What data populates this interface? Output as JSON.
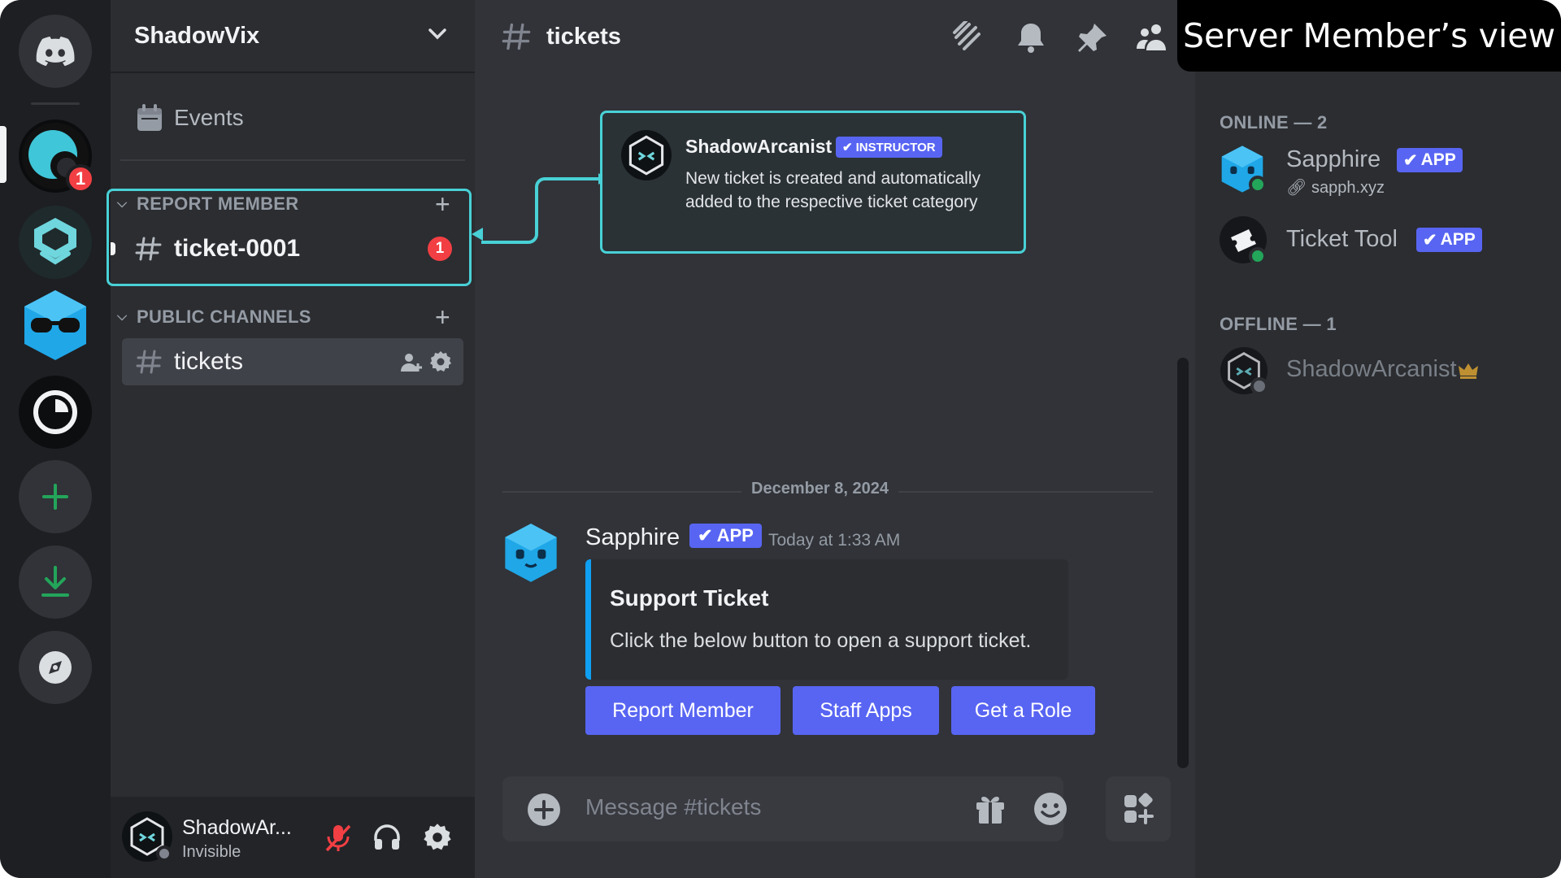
{
  "server": {
    "name": "ShadowVix",
    "events_label": "Events"
  },
  "rail": {
    "notification_count": "1"
  },
  "categories": [
    {
      "name": "REPORT MEMBER",
      "channels": [
        {
          "name": "ticket-0001",
          "unread": "1"
        }
      ]
    },
    {
      "name": "PUBLIC CHANNELS",
      "channels": [
        {
          "name": "tickets"
        }
      ]
    }
  ],
  "user_panel": {
    "name": "ShadowAr...",
    "status": "Invisible"
  },
  "channel_header": {
    "name": "tickets"
  },
  "view_label": "Server Member’s view",
  "callout": {
    "author": "ShadowArcanist",
    "tag": "INSTRUCTOR",
    "text": "New ticket is created and automatically added to the respective ticket category"
  },
  "chat": {
    "date_divider": "December 8, 2024",
    "message": {
      "author": "Sapphire",
      "app_tag": "APP",
      "timestamp": "Today at 1:33 AM",
      "embed_title": "Support Ticket",
      "embed_description": "Click the below button to open a support ticket.",
      "buttons": [
        "Report Member",
        "Staff Apps",
        "Get a Role"
      ]
    },
    "composer_placeholder": "Message #tickets"
  },
  "members": {
    "online_header": "ONLINE — 2",
    "offline_header": "OFFLINE — 1",
    "online": [
      {
        "name": "Sapphire",
        "tag": "APP",
        "sub": "sapph.xyz"
      },
      {
        "name": "Ticket Tool",
        "tag": "APP"
      }
    ],
    "offline": [
      {
        "name": "ShadowArcanist"
      }
    ]
  },
  "colors": {
    "accent": "#5865f2",
    "highlight": "#48d1d6",
    "unread_badge": "#f23f43",
    "online": "#23a55a"
  }
}
